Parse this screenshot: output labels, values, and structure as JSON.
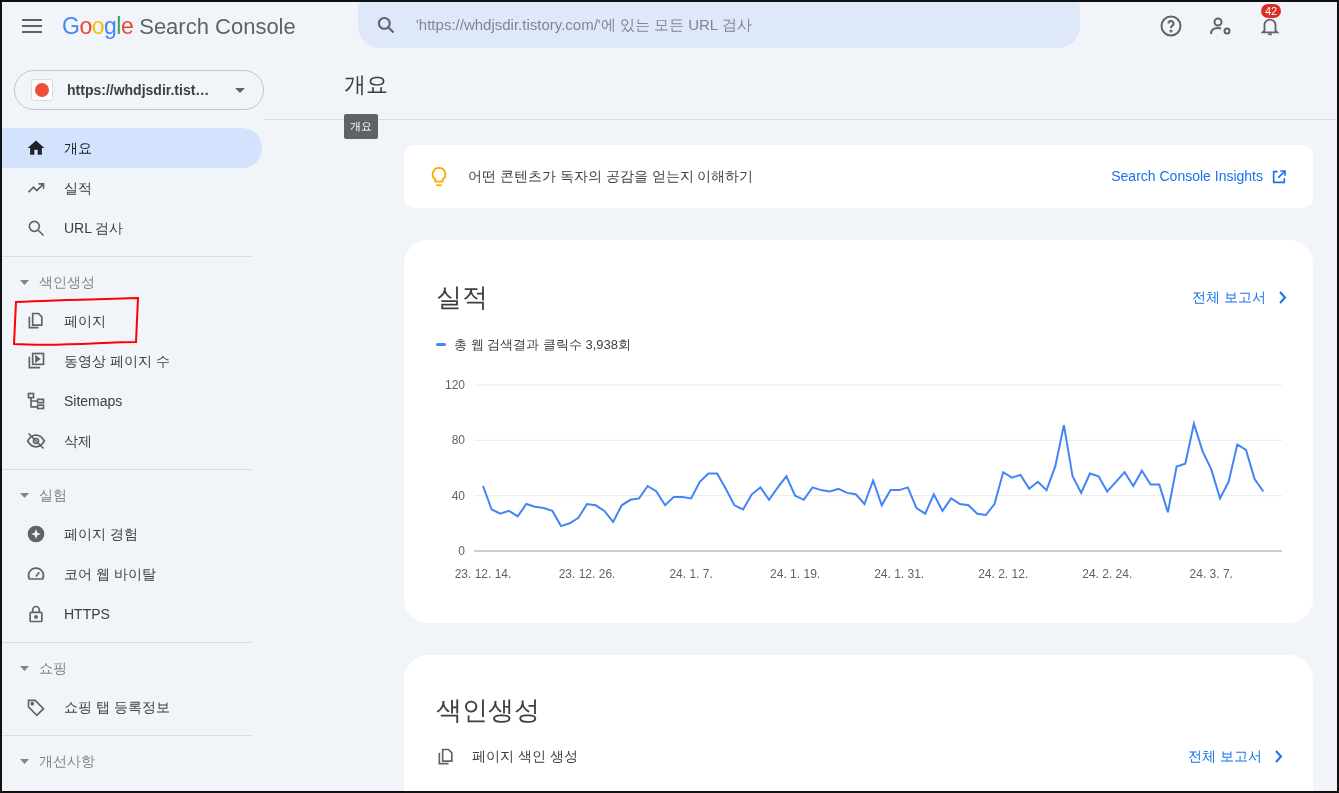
{
  "header": {
    "logo_text": "Google",
    "product": "Search Console",
    "search_placeholder": "'https://whdjsdir.tistory.com/'에 있는 모든 URL 검사",
    "notification_count": "42"
  },
  "property": {
    "label": "https://whdjsdir.tist…"
  },
  "sidebar": {
    "sections": [
      {
        "items": [
          {
            "label": "개요",
            "kind": "home",
            "selected": true,
            "highlighted": false
          },
          {
            "label": "실적",
            "kind": "trend",
            "selected": false,
            "highlighted": false
          },
          {
            "label": "URL 검사",
            "kind": "search",
            "selected": false,
            "highlighted": false
          }
        ]
      },
      {
        "heading": "색인생성",
        "expanded": true,
        "items": [
          {
            "label": "페이지",
            "kind": "pages",
            "selected": false,
            "highlighted": true
          },
          {
            "label": "동영상 페이지 수",
            "kind": "video",
            "selected": false,
            "highlighted": false
          },
          {
            "label": "Sitemaps",
            "kind": "sitemap",
            "selected": false,
            "highlighted": false
          },
          {
            "label": "삭제",
            "kind": "eye-off",
            "selected": false,
            "highlighted": false
          }
        ]
      },
      {
        "heading": "실험",
        "expanded": true,
        "items": [
          {
            "label": "페이지 경험",
            "kind": "star-circle",
            "selected": false,
            "highlighted": false
          },
          {
            "label": "코어 웹 바이탈",
            "kind": "gauge",
            "selected": false,
            "highlighted": false
          },
          {
            "label": "HTTPS",
            "kind": "lock",
            "selected": false,
            "highlighted": false
          }
        ]
      },
      {
        "heading": "쇼핑",
        "expanded": true,
        "items": [
          {
            "label": "쇼핑 탭 등록정보",
            "kind": "tag",
            "selected": false,
            "highlighted": false
          }
        ]
      },
      {
        "heading": "개선사항",
        "expanded": true
      }
    ]
  },
  "main": {
    "title": "개요",
    "tooltip": "개요",
    "insight": {
      "text": "어떤 콘텐츠가 독자의 공감을 얻는지 이해하기",
      "link": "Search Console Insights"
    },
    "performance": {
      "title": "실적",
      "link": "전체 보고서",
      "legend_total": "3,938회",
      "chart_data": {
        "type": "line",
        "ylim": [
          0,
          120
        ],
        "yticks": [
          0,
          40,
          80,
          120
        ],
        "categories": [
          "23. 12. 14.",
          null,
          null,
          null,
          null,
          null,
          null,
          null,
          null,
          null,
          null,
          null,
          "23. 12. 26.",
          null,
          null,
          null,
          null,
          null,
          null,
          null,
          null,
          null,
          null,
          null,
          "24. 1. 7.",
          null,
          null,
          null,
          null,
          null,
          null,
          null,
          null,
          null,
          null,
          null,
          "24. 1. 19.",
          null,
          null,
          null,
          null,
          null,
          null,
          null,
          null,
          null,
          null,
          null,
          "24. 1. 31.",
          null,
          null,
          null,
          null,
          null,
          null,
          null,
          null,
          null,
          null,
          null,
          "24. 2. 12.",
          null,
          null,
          null,
          null,
          null,
          null,
          null,
          null,
          null,
          null,
          null,
          "24. 2. 24.",
          null,
          null,
          null,
          null,
          null,
          null,
          null,
          null,
          null,
          null,
          null,
          "24. 3. 7.",
          null,
          null,
          null,
          null,
          null,
          null
        ],
        "series": [
          {
            "name": "총 웹 검색결과 클릭수",
            "color": "#4285f4",
            "values": [
              47,
              30,
              27,
              29,
              25,
              34,
              32,
              31,
              29,
              18,
              20,
              24,
              34,
              33,
              29,
              21,
              33,
              37,
              38,
              47,
              43,
              33,
              39,
              39,
              38,
              50,
              56,
              56,
              45,
              33,
              30,
              41,
              46,
              37,
              46,
              54,
              40,
              37,
              46,
              44,
              43,
              45,
              42,
              41,
              34,
              51,
              33,
              44,
              44,
              46,
              31,
              27,
              41,
              29,
              38,
              34,
              33,
              27,
              26,
              34,
              57,
              53,
              55,
              45,
              50,
              44,
              61,
              91,
              54,
              42,
              56,
              54,
              43,
              50,
              57,
              47,
              58,
              48,
              48,
              28,
              61,
              63,
              92,
              72,
              59,
              38,
              50,
              77,
              73,
              52,
              43
            ]
          }
        ]
      }
    },
    "indexing": {
      "title": "색인생성",
      "row_label": "페이지 색인 생성",
      "link": "전체 보고서"
    }
  }
}
